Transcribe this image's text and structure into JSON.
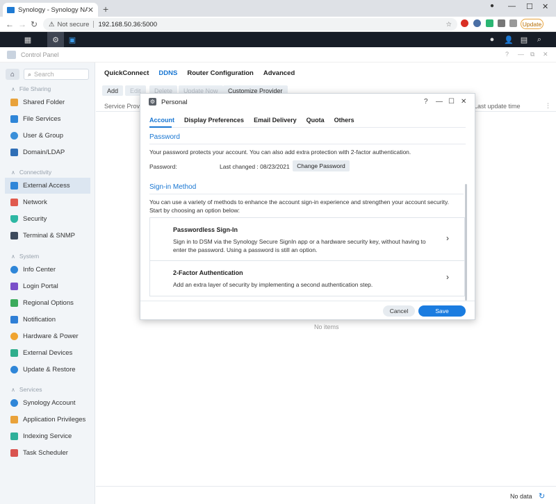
{
  "browser": {
    "tab_title": "Synology - Synology NAS",
    "url_warning": "Not secure",
    "url": "192.168.50.36:5000",
    "update_label": "Update"
  },
  "control_panel": {
    "title": "Control Panel",
    "search_placeholder": "Search",
    "sections": [
      {
        "title": "File Sharing",
        "items": [
          "Shared Folder",
          "File Services",
          "User & Group",
          "Domain/LDAP"
        ]
      },
      {
        "title": "Connectivity",
        "items": [
          "External Access",
          "Network",
          "Security",
          "Terminal & SNMP"
        ]
      },
      {
        "title": "System",
        "items": [
          "Info Center",
          "Login Portal",
          "Regional Options",
          "Notification",
          "Hardware & Power",
          "External Devices",
          "Update & Restore"
        ]
      },
      {
        "title": "Services",
        "items": [
          "Synology Account",
          "Application Privileges",
          "Indexing Service",
          "Task Scheduler"
        ]
      }
    ],
    "active_item": "External Access"
  },
  "external_access": {
    "tabs": [
      "QuickConnect",
      "DDNS",
      "Router Configuration",
      "Advanced"
    ],
    "active_tab": "DDNS",
    "toolbar": [
      "Add",
      "Edit",
      "Delete",
      "Update Now",
      "Customize Provider"
    ],
    "columns": [
      "Service Provider",
      "Last update time"
    ],
    "empty_text": "No items",
    "footer_status": "No data"
  },
  "dialog": {
    "title": "Personal",
    "tabs": [
      "Account",
      "Display Preferences",
      "Email Delivery",
      "Quota",
      "Others"
    ],
    "active_tab": "Account",
    "password_heading": "Password",
    "password_desc": "Your password protects your account. You can also add extra protection with 2-factor authentication.",
    "password_label": "Password:",
    "last_changed": "Last changed : 08/23/2021",
    "change_password_label": "Change Password",
    "signin_heading": "Sign-in Method",
    "signin_desc": "You can use a variety of methods to enhance the account sign-in experience and strengthen your account security. Start by choosing an option below:",
    "options": [
      {
        "title": "Passwordless Sign-In",
        "desc": "Sign in to DSM via the Synology Secure SignIn app or a hardware security key, without having to enter the password. Using a password is still an option."
      },
      {
        "title": "2-Factor Authentication",
        "desc": "Add an extra layer of security by implementing a second authentication step."
      }
    ],
    "cancel_label": "Cancel",
    "save_label": "Save"
  },
  "colors": {
    "accent": "#1876d2",
    "taskbar": "#171d27",
    "sidebar_bg": "#f2f5f8"
  }
}
